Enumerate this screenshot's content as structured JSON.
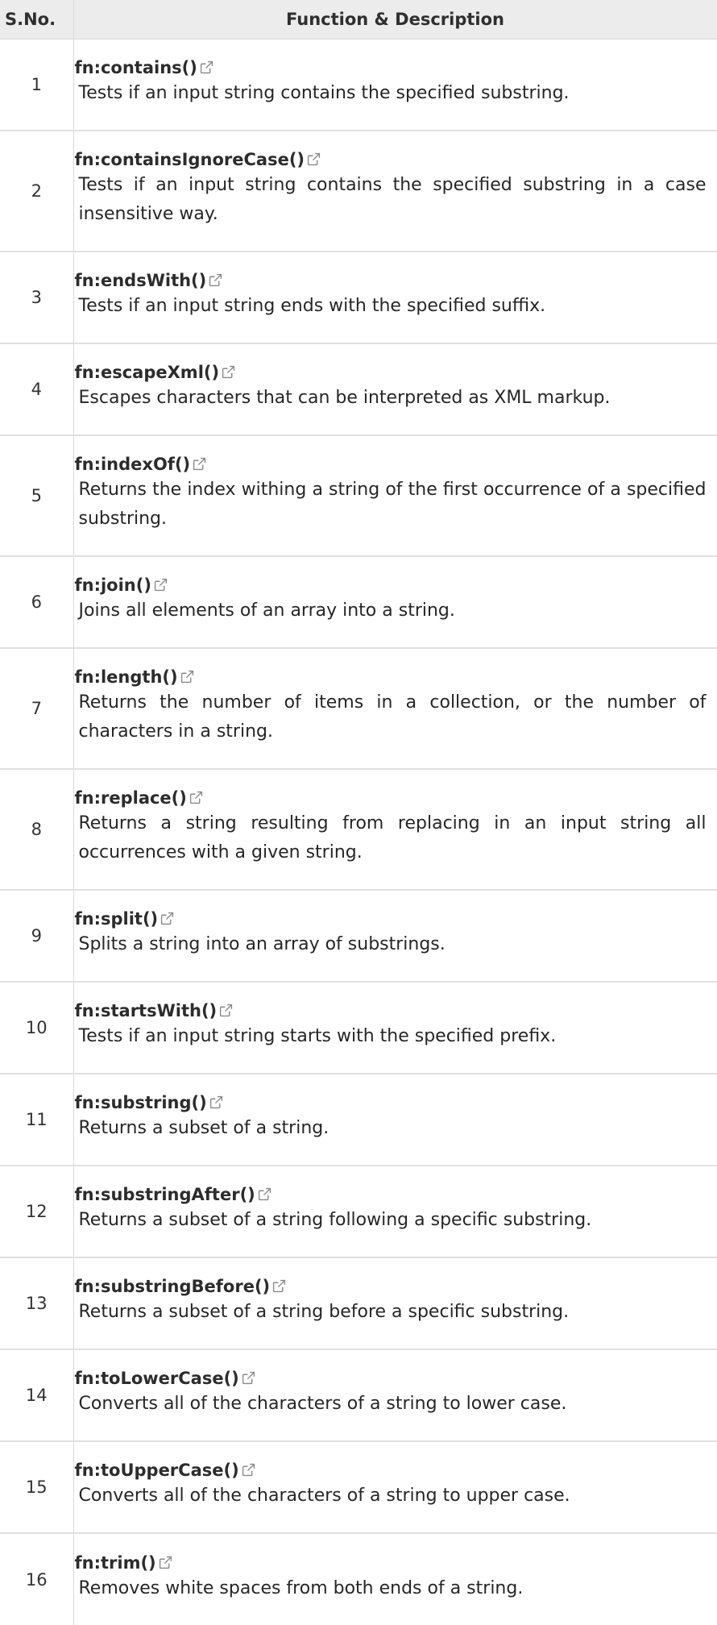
{
  "table": {
    "headers": {
      "sno": "S.No.",
      "description": "Function & Description"
    },
    "rows": [
      {
        "num": "1",
        "name": "fn:contains()",
        "description": "Tests if an input string contains the specified substring.",
        "lines": 1
      },
      {
        "num": "2",
        "name": "fn:containsIgnoreCase()",
        "description": "Tests if an input string contains the specified substring in a case insensitive way.",
        "lines": 2
      },
      {
        "num": "3",
        "name": "fn:endsWith()",
        "description": "Tests if an input string ends with the specified suffix.",
        "lines": 1
      },
      {
        "num": "4",
        "name": "fn:escapeXml()",
        "description": "Escapes characters that can be interpreted as XML markup.",
        "lines": 1
      },
      {
        "num": "5",
        "name": "fn:indexOf()",
        "description": "Returns the index withing a string of the first occurrence of a specified substring.",
        "lines": 2
      },
      {
        "num": "6",
        "name": "fn:join()",
        "description": "Joins all elements of an array into a string.",
        "lines": 1
      },
      {
        "num": "7",
        "name": "fn:length()",
        "description": "Returns the number of items in a collection, or the number of characters in a string.",
        "lines": 2
      },
      {
        "num": "8",
        "name": "fn:replace()",
        "description": "Returns a string resulting from replacing in an input string all occurrences with a given string.",
        "lines": 2
      },
      {
        "num": "9",
        "name": "fn:split()",
        "description": "Splits a string into an array of substrings.",
        "lines": 1
      },
      {
        "num": "10",
        "name": "fn:startsWith()",
        "description": "Tests if an input string starts with the specified prefix.",
        "lines": 1
      },
      {
        "num": "11",
        "name": "fn:substring()",
        "description": "Returns a subset of a string.",
        "lines": 1
      },
      {
        "num": "12",
        "name": "fn:substringAfter()",
        "description": "Returns a subset of a string following a specific substring.",
        "lines": 1
      },
      {
        "num": "13",
        "name": "fn:substringBefore()",
        "description": "Returns a subset of a string before a specific substring.",
        "lines": 1
      },
      {
        "num": "14",
        "name": "fn:toLowerCase()",
        "description": "Converts all of the characters of a string to lower case.",
        "lines": 1
      },
      {
        "num": "15",
        "name": "fn:toUpperCase()",
        "description": "Converts all of the characters of a string to upper case.",
        "lines": 1
      },
      {
        "num": "16",
        "name": "fn:trim()",
        "description": "Removes white spaces from both ends of a string.",
        "lines": 1
      }
    ]
  },
  "icons": {
    "external_link": "external-link-icon"
  },
  "colors": {
    "header_bg": "#ececec",
    "border": "#d9d9d9",
    "text": "#2b2b2b"
  }
}
